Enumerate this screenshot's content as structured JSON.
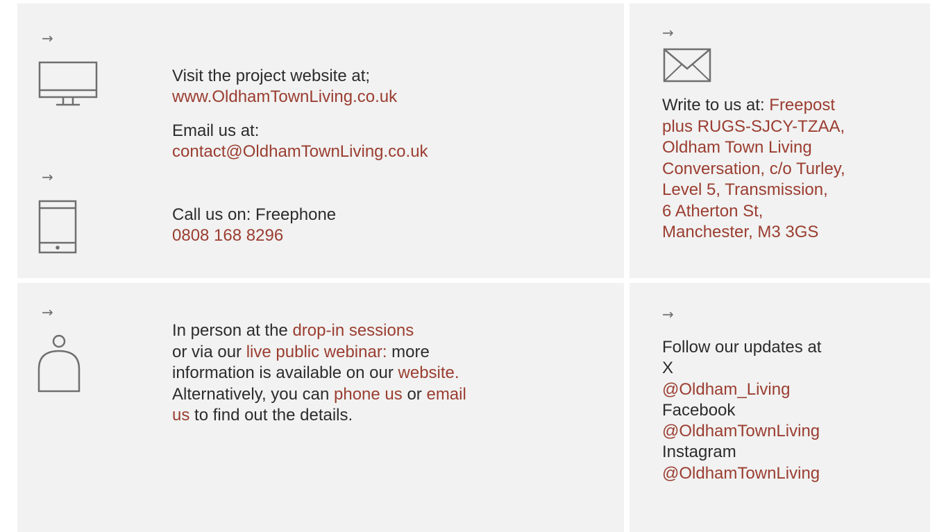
{
  "contact": {
    "website_intro": "Visit the project website at;",
    "website_url": "www.OldhamTownLiving.co.uk",
    "email_intro": "Email us at:",
    "email_address": "contact@OldhamTownLiving.co.uk",
    "call_intro": "Call us on: Freephone",
    "phone_number": "0808 168 8296"
  },
  "post": {
    "intro": "Write to us at:",
    "address_line1": "Freepost",
    "address_line2": "plus RUGS-SJCY-TZAA,",
    "address_line3": "Oldham Town Living",
    "address_line4": "Conversation, c/o Turley,",
    "address_line5": "Level 5, Transmission,",
    "address_line6": "6 Atherton St,",
    "address_line7": "Manchester, M3 3GS"
  },
  "person": {
    "l1_text": "In person at the",
    "l1_link": "drop-in sessions",
    "l2_text": "or via our",
    "l2_link": "live public webinar:",
    "l2_tail": "more",
    "l3_text": "information is available on our",
    "l3_link": "website.",
    "l4_text": "Alternatively, you can",
    "l4_link1": "phone us",
    "l4_mid": "or",
    "l4_link2": "email",
    "l5_link": "us",
    "l5_text": "to find out the details."
  },
  "social": {
    "intro": "Follow our updates at",
    "x_label": "X",
    "x_handle": "@Oldham_Living",
    "facebook_label": "Facebook",
    "facebook_handle": "@OldhamTownLiving",
    "instagram_label": "Instagram",
    "instagram_handle": "@OldhamTownLiving"
  },
  "icons": {
    "arrow": "→",
    "desktop": "desktop-icon",
    "phone": "mobile-phone-icon",
    "envelope": "envelope-icon",
    "person": "person-icon"
  },
  "colors": {
    "link": "#9b3d31",
    "text": "#2c2c2c",
    "panel": "#f1f2f1",
    "icon": "#6f6f6f"
  }
}
